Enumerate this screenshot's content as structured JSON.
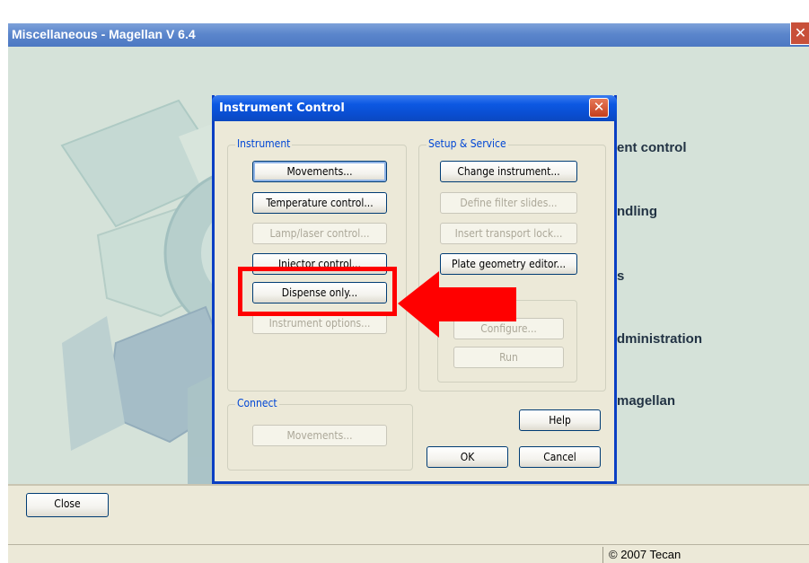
{
  "main_window": {
    "title": "Miscellaneous - Magellan V 6.4",
    "close_glyph": "✕",
    "menu_labels": [
      "ent control",
      "ndling",
      "s",
      "dministration",
      "magellan"
    ],
    "close_button": "Close",
    "copyright": "© 2007 Tecan"
  },
  "dialog": {
    "title": "Instrument Control",
    "close_glyph": "✕",
    "instrument_group": {
      "label": "Instrument",
      "buttons": [
        "Movements...",
        "Temperature control...",
        "Lamp/laser control...",
        "Injector control...",
        "Dispense only...",
        "Instrument options..."
      ]
    },
    "setup_group": {
      "label": "Setup & Service",
      "buttons": [
        "Change instrument...",
        "Define filter slides...",
        "Insert transport lock...",
        "Plate geometry editor..."
      ]
    },
    "sub_group": {
      "buttons": [
        "Configure...",
        "Run"
      ]
    },
    "connect_group": {
      "label": "Connect",
      "buttons": [
        "Movements..."
      ]
    },
    "help_button": "Help",
    "ok_button": "OK",
    "cancel_button": "Cancel"
  },
  "annotation": {
    "highlight_color": "#ff0000",
    "arrow_color": "#ff0000"
  }
}
